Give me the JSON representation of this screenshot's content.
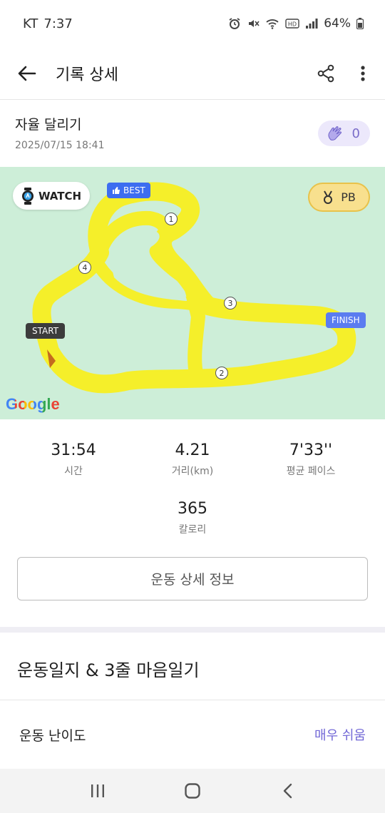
{
  "status_bar": {
    "carrier": "KT",
    "time": "7:37",
    "battery": "64%"
  },
  "header": {
    "title": "기록 상세"
  },
  "record": {
    "title": "자율 달리기",
    "datetime": "2025/07/15 18:41",
    "clap_count": "0"
  },
  "map": {
    "watch_label": "WATCH",
    "pb_label": "PB",
    "best_label": "BEST",
    "start_label": "START",
    "finish_label": "FINISH",
    "km_markers": [
      "1",
      "2",
      "3",
      "4"
    ],
    "attribution": "Google",
    "route_color": "#f5ef2a",
    "background_color": "#cdeed8"
  },
  "stats": {
    "time": {
      "value": "31:54",
      "label": "시간"
    },
    "distance": {
      "value": "4.21",
      "label": "거리(km)"
    },
    "pace": {
      "value": "7'33''",
      "label": "평균 페이스"
    },
    "calories": {
      "value": "365",
      "label": "칼로리"
    }
  },
  "detail_button": "운동 상세 정보",
  "journal": {
    "title": "운동일지 & 3줄 마음일기",
    "difficulty_label": "운동 난이도",
    "difficulty_value": "매우 쉬움"
  },
  "colors": {
    "accent_purple": "#7167d6",
    "pb_gold": "#f8e08e",
    "best_blue": "#3d6df0"
  }
}
